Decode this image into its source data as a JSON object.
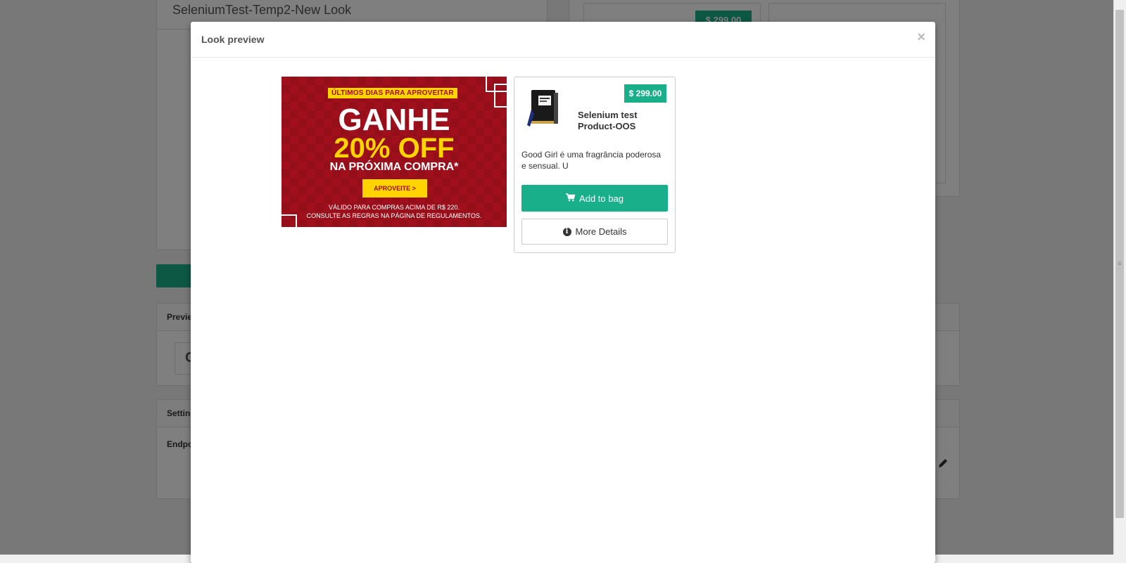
{
  "background": {
    "look_title": "SeleniumTest-Temp2-New Look",
    "preview_section_label": "Previe",
    "preview_box_text": "C",
    "settings_section_label": "Settin",
    "endpoint_label": "Endpo",
    "bg_price": "$ 299.00"
  },
  "modal": {
    "title": "Look preview",
    "close_symbol": "×"
  },
  "banner": {
    "tag": "ÚLTIMOS DIAS PARA APROVEITAR",
    "headline": "GANHE",
    "offer": "20% OFF",
    "subline": "NA PRÓXIMA COMPRA*",
    "cta": "APROVEITE >",
    "fine_print_1": "VÁLIDO PARA COMPRAS ACIMA DE R$ 220.",
    "fine_print_2": "CONSULTE AS REGRAS NA PÁGINA DE REGULAMENTOS.",
    "colors": {
      "background": "#a0101c",
      "accent": "#ffd400"
    }
  },
  "product": {
    "price": "$ 299.00",
    "name": "Selenium test Product-OOS",
    "description": "Good Girl é uma fragrância poderosa e sensual. U",
    "add_to_bag_label": "Add to bag",
    "add_to_bag_icon": "shopping-cart-icon",
    "more_details_label": "More Details",
    "more_details_icon": "info-circle-icon",
    "accent_color": "#1aaf8b"
  }
}
